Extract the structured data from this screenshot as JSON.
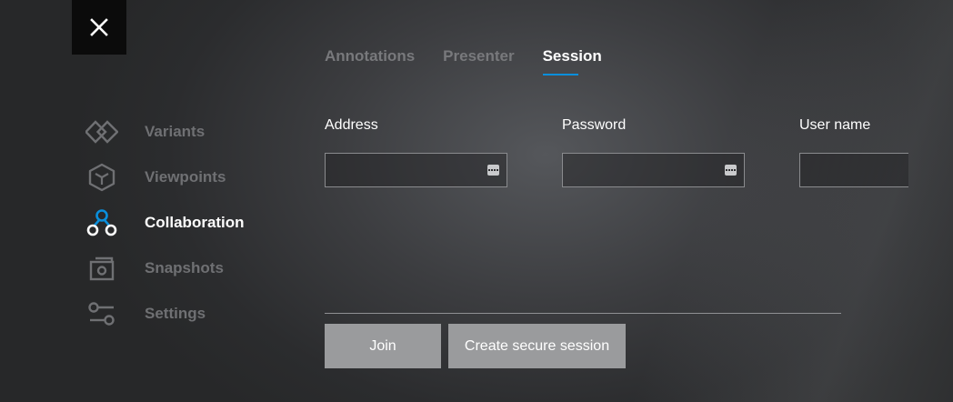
{
  "colors": {
    "accent": "#0a8fdc",
    "active_text": "#ffffff",
    "inactive_text": "#6f7073",
    "button_bg": "#9a9b9d"
  },
  "close_button": {
    "icon": "close-icon"
  },
  "tabs": [
    {
      "label": "Annotations",
      "active": false
    },
    {
      "label": "Presenter",
      "active": false
    },
    {
      "label": "Session",
      "active": true
    }
  ],
  "sidebar": {
    "items": [
      {
        "label": "Variants",
        "icon": "variants-icon",
        "active": false
      },
      {
        "label": "Viewpoints",
        "icon": "viewpoints-icon",
        "active": false
      },
      {
        "label": "Collaboration",
        "icon": "collaboration-icon",
        "active": true
      },
      {
        "label": "Snapshots",
        "icon": "snapshots-icon",
        "active": false
      },
      {
        "label": "Settings",
        "icon": "settings-icon",
        "active": false
      }
    ]
  },
  "form": {
    "address": {
      "label": "Address",
      "value": "",
      "icon": "password-dots-icon"
    },
    "password": {
      "label": "Password",
      "value": "",
      "icon": "password-dots-icon"
    },
    "username": {
      "label": "User name",
      "value": ""
    }
  },
  "actions": {
    "join_label": "Join",
    "create_label": "Create secure session"
  }
}
